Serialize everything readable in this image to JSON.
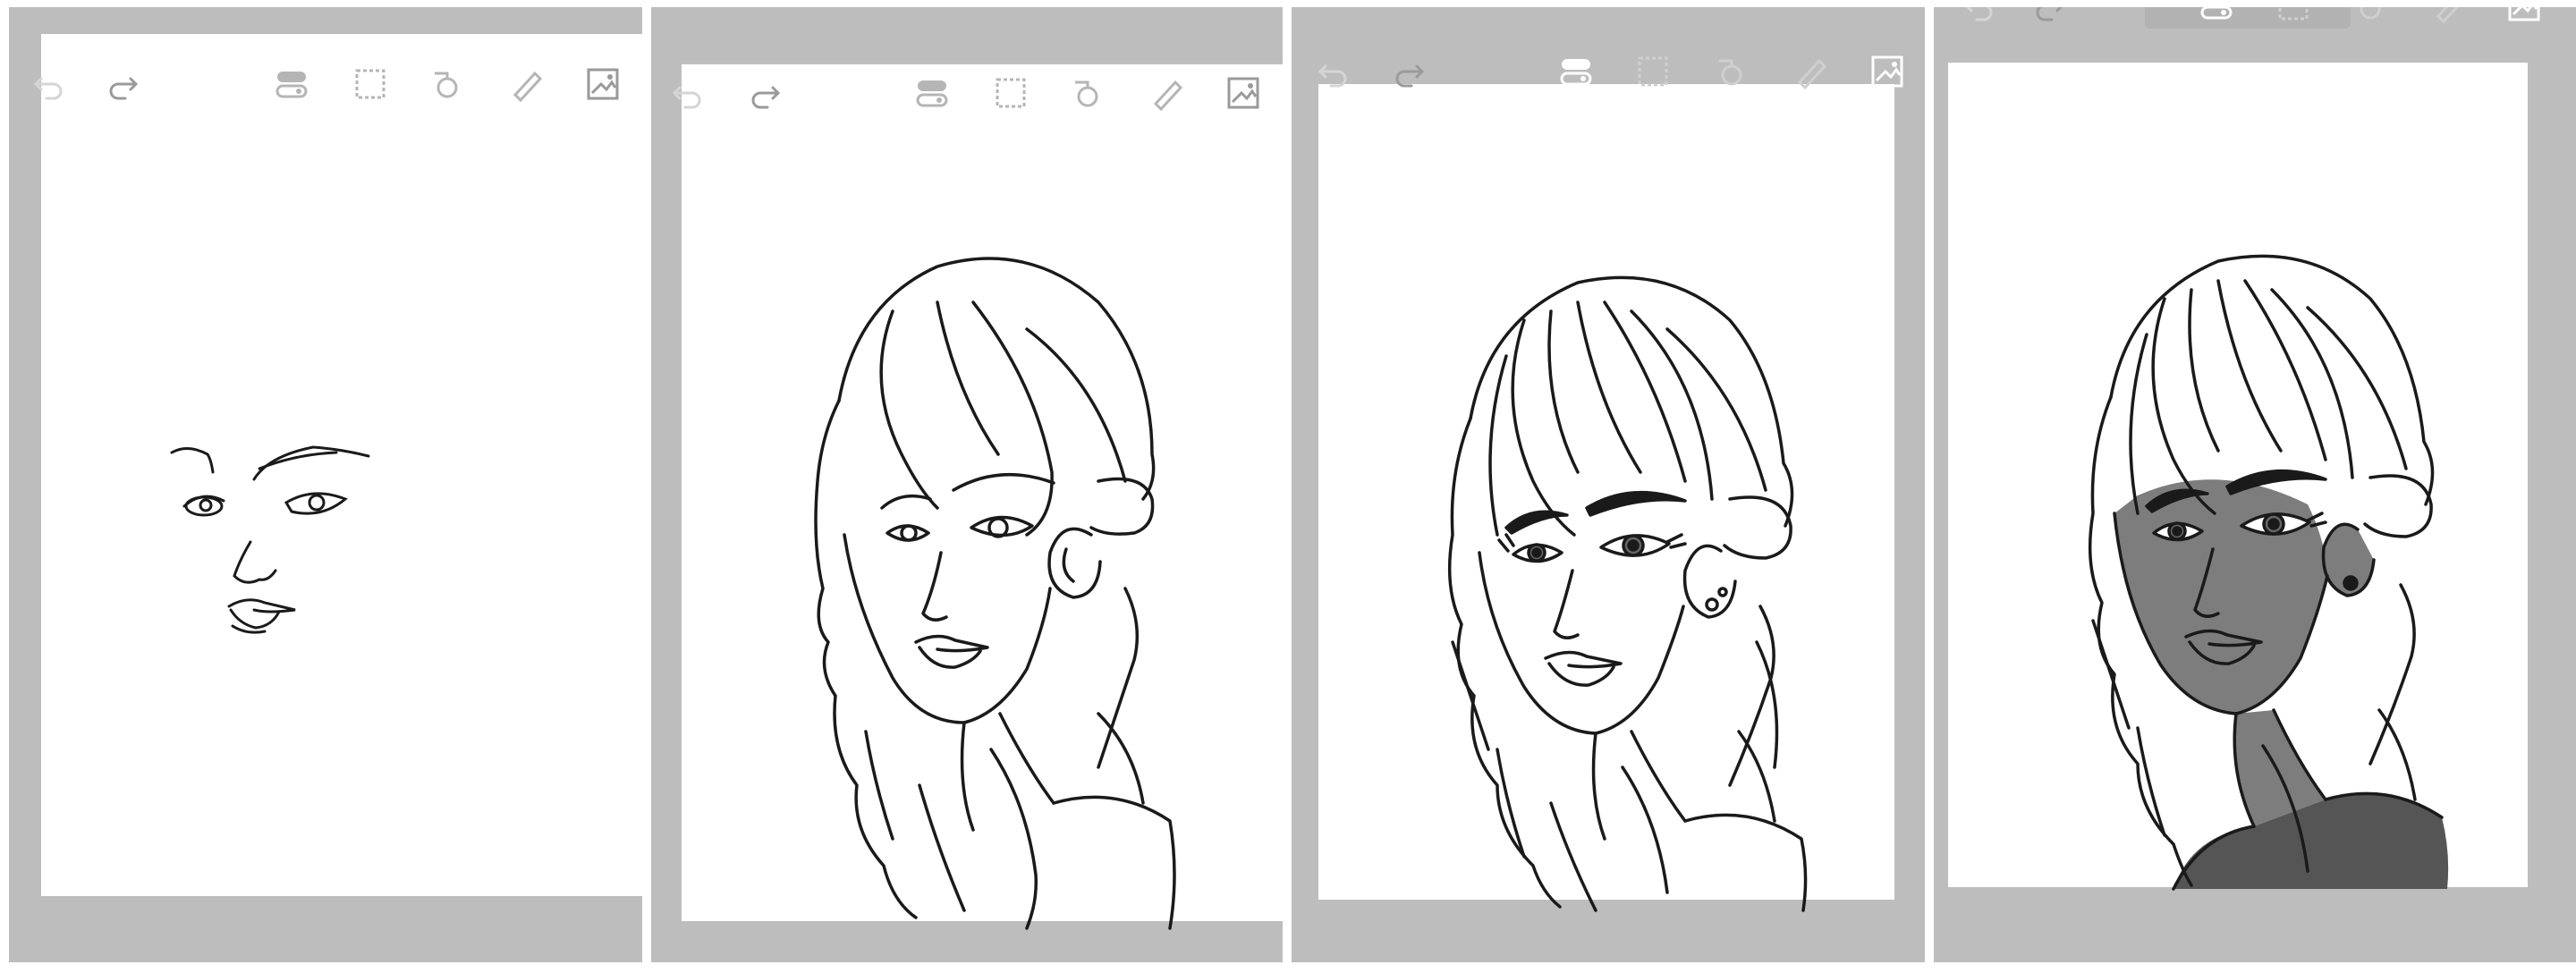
{
  "app": {
    "description": ""
  },
  "toolbar": {
    "icons": [
      {
        "name": "undo-icon"
      },
      {
        "name": "redo-icon"
      },
      {
        "name": "layer-toggle-icon"
      },
      {
        "name": "selection-icon"
      },
      {
        "name": "transform-icon"
      },
      {
        "name": "ruler-icon"
      },
      {
        "name": "gallery-icon"
      }
    ]
  },
  "panels": [
    {
      "step": "1"
    },
    {
      "step": "2"
    },
    {
      "step": "3"
    },
    {
      "step": "4"
    }
  ],
  "colors": {
    "background": "#bdbdbd",
    "canvas": "#ffffff",
    "stroke": "#1a1a1a",
    "icon_light": "#9a9a9a",
    "skin": "#7d7d7d",
    "hoodie": "#555555"
  }
}
